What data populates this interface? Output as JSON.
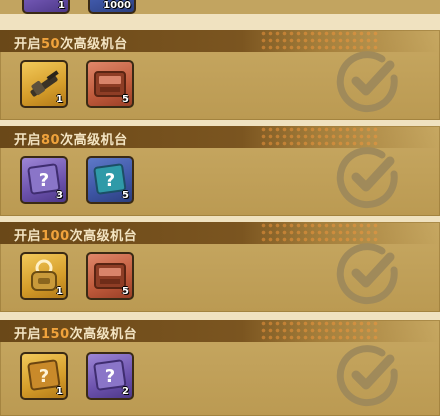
{
  "top_partial": {
    "items": [
      {
        "type": "purple",
        "count": "1"
      },
      {
        "type": "blue",
        "count": "1000"
      }
    ]
  },
  "milestones": [
    {
      "label_prefix": "开启",
      "number": "50",
      "label_suffix": "次高级机台",
      "items": [
        {
          "type": "gold",
          "icon": "gun-icon",
          "count": "1"
        },
        {
          "type": "orange",
          "icon": "ticket-box-icon",
          "count": "5"
        }
      ],
      "claimed": true
    },
    {
      "label_prefix": "开启",
      "number": "80",
      "label_suffix": "次高级机台",
      "items": [
        {
          "type": "purple",
          "icon": "mystery-box-icon",
          "count": "3"
        },
        {
          "type": "blue",
          "icon": "mystery-box-icon",
          "count": "5"
        }
      ],
      "claimed": true
    },
    {
      "label_prefix": "开启",
      "number": "100",
      "label_suffix": "次高级机台",
      "items": [
        {
          "type": "gold",
          "icon": "backpack-icon",
          "count": "1"
        },
        {
          "type": "orange",
          "icon": "ticket-box-icon",
          "count": "5"
        }
      ],
      "claimed": true
    },
    {
      "label_prefix": "开启",
      "number": "150",
      "label_suffix": "次高级机台",
      "items": [
        {
          "type": "gold",
          "icon": "mystery-box-icon",
          "count": "1"
        },
        {
          "type": "purple",
          "icon": "mystery-box-icon",
          "count": "2"
        }
      ],
      "claimed": true
    }
  ],
  "colors": {
    "number_accent": "#f0a33c",
    "header_text": "#f3e4c2",
    "check_color": "#a08a5a"
  }
}
